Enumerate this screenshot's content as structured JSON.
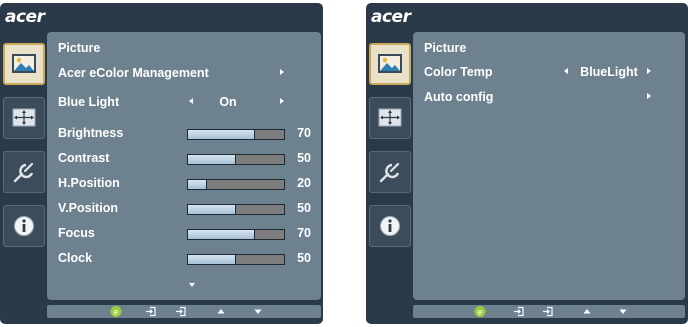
{
  "left_osd": {
    "logo": "acer",
    "side_icons": [
      "picture-icon",
      "display-position-icon",
      "settings-icon",
      "information-icon"
    ],
    "selected_icon": "picture-icon",
    "menu_title": "Picture",
    "items": {
      "ecolor_label": "Acer eColor Management",
      "blue_light_label": "Blue Light",
      "blue_light_value": "On"
    },
    "sliders": [
      {
        "label": "Brightness",
        "value": 70
      },
      {
        "label": "Contrast",
        "value": 50
      },
      {
        "label": "H.Position",
        "value": 20
      },
      {
        "label": "V.Position",
        "value": 50
      },
      {
        "label": "Focus",
        "value": 70
      },
      {
        "label": "Clock",
        "value": 50
      }
    ],
    "footer_buttons": [
      "eco-mode-icon",
      "input-icon",
      "up-arrow-icon",
      "down-arrow-icon"
    ]
  },
  "right_osd": {
    "logo": "acer",
    "side_icons": [
      "picture-icon",
      "display-position-icon",
      "settings-icon",
      "information-icon"
    ],
    "selected_icon": "picture-icon",
    "menu_title": "Picture",
    "items": {
      "color_temp_label": "Color Temp",
      "color_temp_value": "BlueLight",
      "auto_config_label": "Auto config"
    },
    "footer_buttons": [
      "eco-mode-icon",
      "input-icon",
      "input-icon",
      "up-arrow-icon",
      "down-arrow-icon"
    ]
  },
  "colors": {
    "frame": "#2b3a48",
    "panel": "#6d818f",
    "slider_fill": "#c2d6e4",
    "slider_track": "#7d7d7d",
    "eco_green": "#9ccc3c",
    "selected_tile": "#e9e2c8"
  }
}
